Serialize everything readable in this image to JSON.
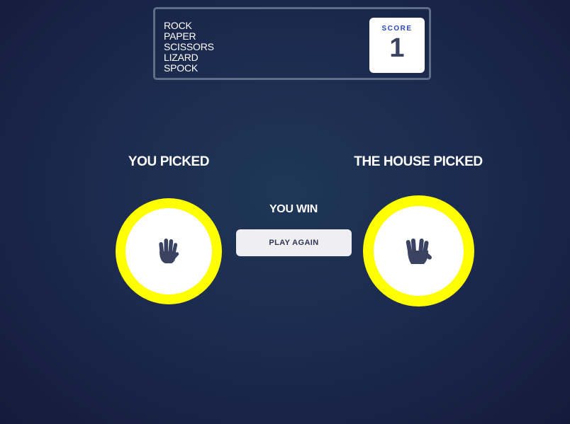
{
  "header": {
    "title_words": [
      "ROCK",
      "PAPER",
      "SCISSORS",
      "LIZARD",
      "SPOCK"
    ],
    "score_label": "SCORE",
    "score_value": "1"
  },
  "player": {
    "heading": "YOU PICKED",
    "choice_icon": "paper-hand-icon"
  },
  "house": {
    "heading": "THE HOUSE PICKED",
    "choice_icon": "spock-hand-icon"
  },
  "result": {
    "text": "YOU WIN",
    "button_label": "PLAY AGAIN"
  },
  "colors": {
    "token_ring": "#ffff00",
    "icon": "#3b4363",
    "score_label": "#2a45c2"
  }
}
